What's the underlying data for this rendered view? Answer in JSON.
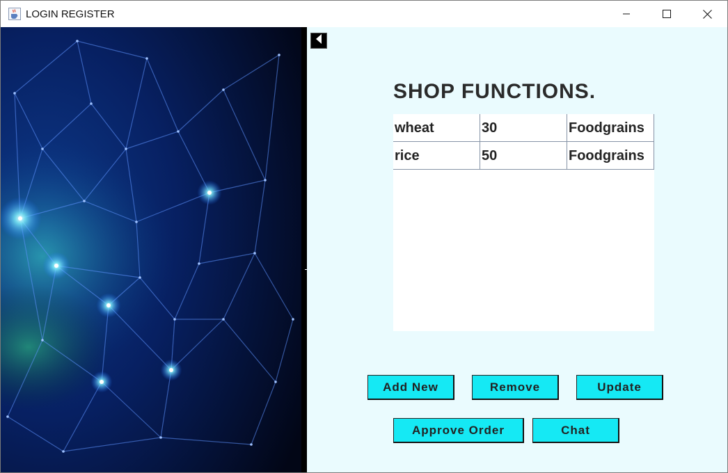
{
  "window": {
    "title": "LOGIN REGISTER"
  },
  "main": {
    "heading": "SHOP FUNCTIONS.",
    "table": {
      "rows": [
        [
          "wheat",
          "30",
          "Foodgrains"
        ],
        [
          "rice",
          "50",
          "Foodgrains"
        ]
      ]
    },
    "buttons": {
      "add_new": "Add New",
      "remove": "Remove",
      "update": "Update",
      "approve_order": "Approve Order",
      "chat": "Chat"
    }
  },
  "colors": {
    "panel_background": "#eafbfe",
    "button_background": "#15e9f4",
    "table_background": "#ffffff"
  },
  "icons": {
    "app": "java-cup-icon",
    "back": "triangle-left-icon",
    "minimize": "minimize-icon",
    "maximize": "maximize-icon",
    "close": "close-icon"
  }
}
